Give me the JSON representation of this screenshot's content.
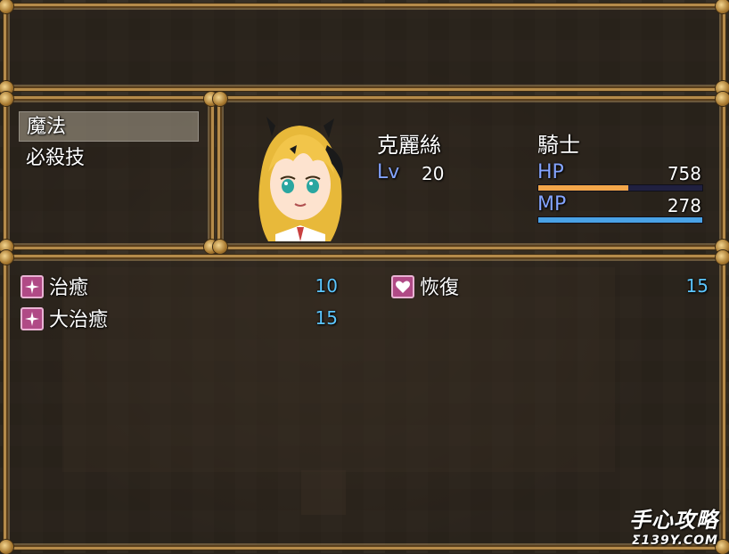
{
  "help": {
    "text": ""
  },
  "skill_types": [
    {
      "label": "魔法",
      "selected": true
    },
    {
      "label": "必殺技",
      "selected": false
    }
  ],
  "actor": {
    "name": "克麗絲",
    "level_label": "Lv",
    "level": "20",
    "class": "騎士",
    "hp_label": "HP",
    "hp": "758",
    "hp_fill": 0.55,
    "mp_label": "MP",
    "mp": "278",
    "mp_fill": 1.0,
    "hp_color": "#f3a64a",
    "mp_color": "#4aa2e6"
  },
  "skills": [
    {
      "name": "治癒",
      "cost": "10",
      "icon": "sparkle-icon"
    },
    {
      "name": "恢復",
      "cost": "15",
      "icon": "heart-icon"
    },
    {
      "name": "大治癒",
      "cost": "15",
      "icon": "sparkle-icon"
    }
  ],
  "watermark": {
    "main": "手心攻略",
    "sub": "Σ139Y.COM"
  }
}
